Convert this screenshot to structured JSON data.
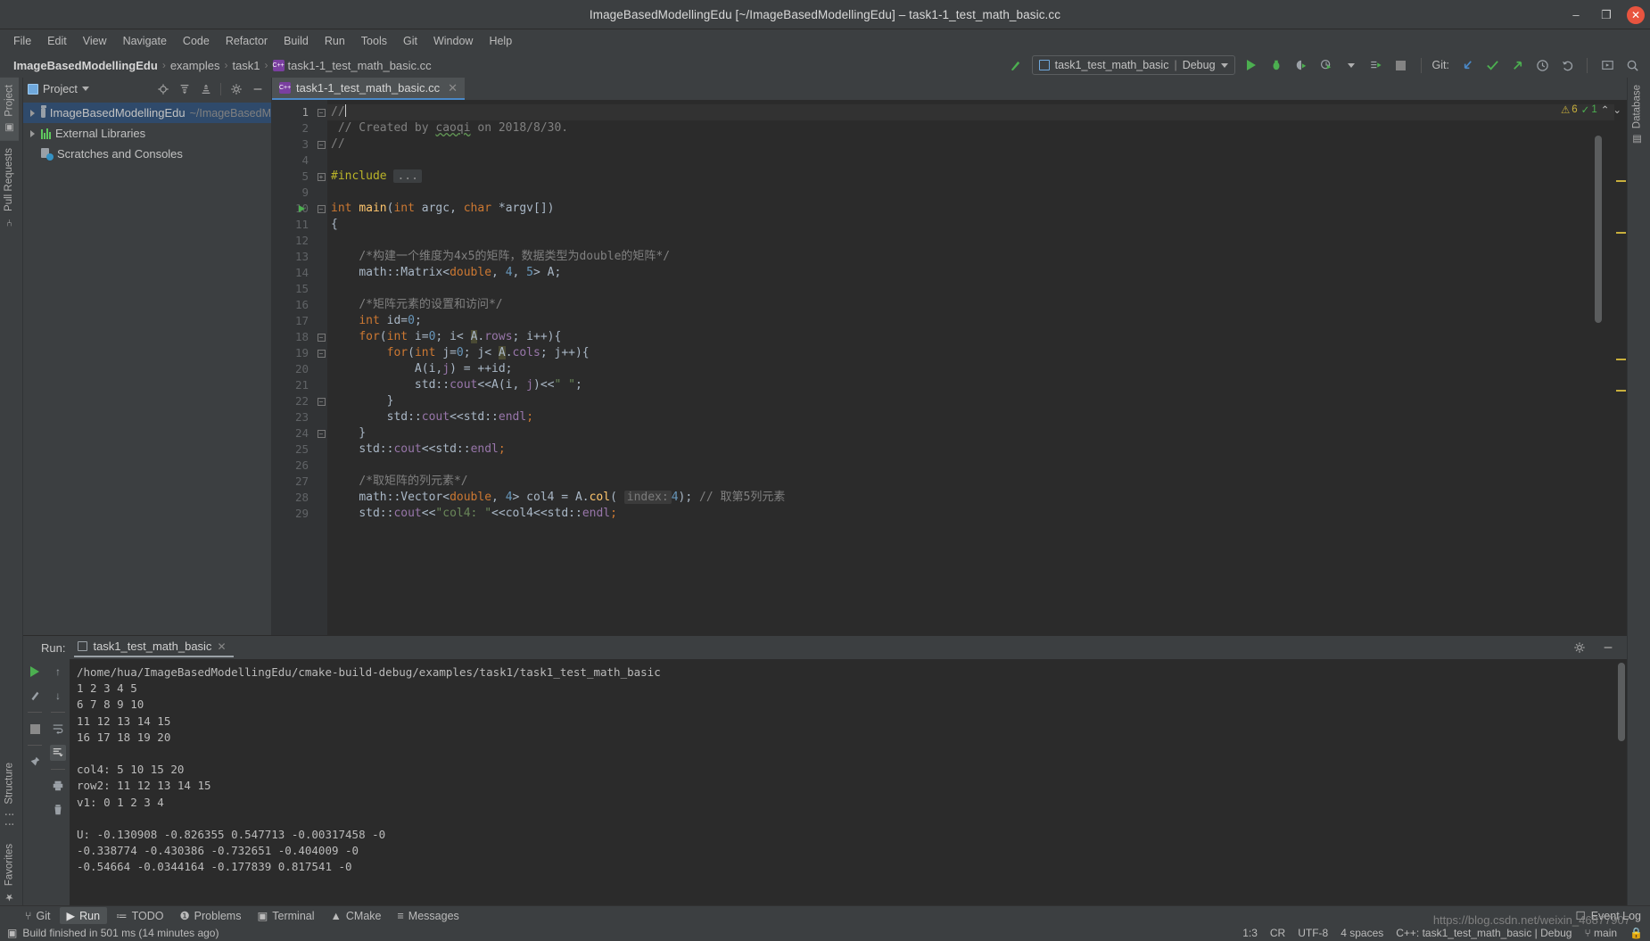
{
  "window": {
    "title": "ImageBasedModellingEdu [~/ImageBasedModellingEdu] – task1-1_test_math_basic.cc",
    "minimize": "–",
    "maximize": "❐",
    "close": "✕"
  },
  "menubar": [
    "File",
    "Edit",
    "View",
    "Navigate",
    "Code",
    "Refactor",
    "Build",
    "Run",
    "Tools",
    "Git",
    "Window",
    "Help"
  ],
  "breadcrumb": {
    "items": [
      "ImageBasedModellingEdu",
      "examples",
      "task1",
      "task1-1_test_math_basic.cc"
    ],
    "separator": "›",
    "file_badge": "C++"
  },
  "toolbar": {
    "run_config": "task1_test_math_basic",
    "run_config_mode": "Debug",
    "run_config_sep": "|",
    "git_label": "Git:",
    "icons": [
      "build-hammer-icon",
      "run-icon",
      "debug-icon",
      "run-with-coverage-icon",
      "profile-icon",
      "attach-icon",
      "stop-icon",
      "git-update-icon",
      "git-commit-icon",
      "git-push-icon",
      "history-icon",
      "rollback-icon",
      "search-everywhere-icon",
      "find-icon"
    ]
  },
  "left_strip": {
    "top_tabs": [
      "Project",
      "Pull Requests"
    ],
    "bottom_tabs": [
      "Structure",
      "Favorites"
    ]
  },
  "right_strip": {
    "tabs": [
      "Database"
    ]
  },
  "project_panel": {
    "title": "Project",
    "actions": [
      "locate-icon",
      "expand-all-icon",
      "collapse-all-icon",
      "settings-gear-icon",
      "hide-icon"
    ],
    "tree": [
      {
        "label": "ImageBasedModellingEdu",
        "path": "~/ImageBasedM",
        "icon": "folder-icon",
        "expandable": true,
        "selected": true
      },
      {
        "label": "External Libraries",
        "path": "",
        "icon": "library-icon",
        "expandable": true,
        "selected": false
      },
      {
        "label": "Scratches and Consoles",
        "path": "",
        "icon": "scratches-icon",
        "expandable": false,
        "selected": false
      }
    ]
  },
  "editor": {
    "tab": {
      "label": "task1-1_test_math_basic.cc",
      "badge": "C++",
      "close": "✕"
    },
    "inspections": {
      "warnings": "6",
      "warn_icon": "⚠",
      "oks": "1",
      "ok_icon": "✓",
      "up_icon": "⌃",
      "down_icon": "⌄"
    },
    "line_numbers": [
      "1",
      "2",
      "3",
      "4",
      "5",
      "9",
      "10",
      "11",
      "12",
      "13",
      "14",
      "15",
      "16",
      "17",
      "18",
      "19",
      "20",
      "21",
      "22",
      "23",
      "24",
      "25",
      "26",
      "27",
      "28",
      "29"
    ],
    "lines": [
      "//",
      "// Created by caoqi on 2018/8/30.",
      "//",
      "",
      "#include ...",
      "",
      "int main(int argc, char *argv[])",
      "{",
      "",
      "    /*构建一个维度为4x5的矩阵，数据类型为double的矩阵*/",
      "    math::Matrix<double, 4, 5> A;",
      "",
      "    /*矩阵元素的设置和访问*/",
      "    int id=0;",
      "    for(int i=0; i< A.rows; i++){",
      "        for(int j=0; j< A.cols; j++){",
      "            A(i,j) = ++id;",
      "            std::cout<<A(i, j)<<\" \";",
      "        }",
      "        std::cout<<std::endl;",
      "    }",
      "    std::cout<<std::endl;",
      "",
      "    /*取矩阵的列元素*/",
      "    math::Vector<double, 4> col4 = A.col( index: 4); // 取第5列元素",
      "    std::cout<<\"col4: \"<<col4<<std::endl;"
    ],
    "param_hint": "index:",
    "folded_include": "..."
  },
  "run_panel": {
    "label": "Run:",
    "tab": "task1_test_math_basic",
    "tab_close": "✕",
    "header_icons": [
      "settings-gear-icon",
      "hide-icon"
    ],
    "left_buttons": [
      "rerun-icon",
      "rerun-failed-icon",
      "stop-icon",
      "pin-icon"
    ],
    "right_buttons": [
      "scroll-up-icon",
      "scroll-down-icon",
      "soft-wrap-icon",
      "scroll-to-end-icon",
      "print-icon",
      "clear-all-icon"
    ],
    "console": [
      "/home/hua/ImageBasedModellingEdu/cmake-build-debug/examples/task1/task1_test_math_basic",
      "1 2 3 4 5",
      "6 7 8 9 10",
      "11 12 13 14 15",
      "16 17 18 19 20",
      "",
      "col4: 5 10 15 20",
      "row2: 11 12 13 14 15",
      "v1: 0 1 2 3 4",
      "",
      "U: -0.130908 -0.826355 0.547713 -0.00317458 -0",
      "-0.338774 -0.430386 -0.732651 -0.404009 -0",
      "-0.54664 -0.0344164 -0.177839 0.817541 -0"
    ]
  },
  "bottom_bar": {
    "items": [
      {
        "label": "Git",
        "icon": "git-branch-icon",
        "active": false
      },
      {
        "label": "Run",
        "icon": "run-play-icon",
        "active": true
      },
      {
        "label": "TODO",
        "icon": "todo-list-icon",
        "active": false
      },
      {
        "label": "Problems",
        "icon": "problems-icon",
        "active": false
      },
      {
        "label": "Terminal",
        "icon": "terminal-icon",
        "active": false
      },
      {
        "label": "CMake",
        "icon": "cmake-icon",
        "active": false
      },
      {
        "label": "Messages",
        "icon": "messages-icon",
        "active": false
      }
    ],
    "event_log": "Event Log",
    "event_log_icon": "event-log-icon"
  },
  "status_bar": {
    "build_message": "Build finished in 501 ms (14 minutes ago)",
    "build_icon": "build-status-icon",
    "caret_position": "1:3",
    "line_separator": "CR",
    "encoding": "UTF-8",
    "indent": "4 spaces",
    "config": "C++: task1_test_math_basic | Debug",
    "branch": "main",
    "branch_icon": "git-branch-icon",
    "lock_icon": "read-only-icon"
  },
  "watermark": "https://blog.csdn.net/weixin_46877907",
  "colors": {
    "bg": "#3c3f41",
    "editor_bg": "#2b2b2b",
    "accent": "#4a88c7",
    "green": "#4caf50",
    "selection": "#2f4a6b",
    "close_red": "#e8543f"
  }
}
